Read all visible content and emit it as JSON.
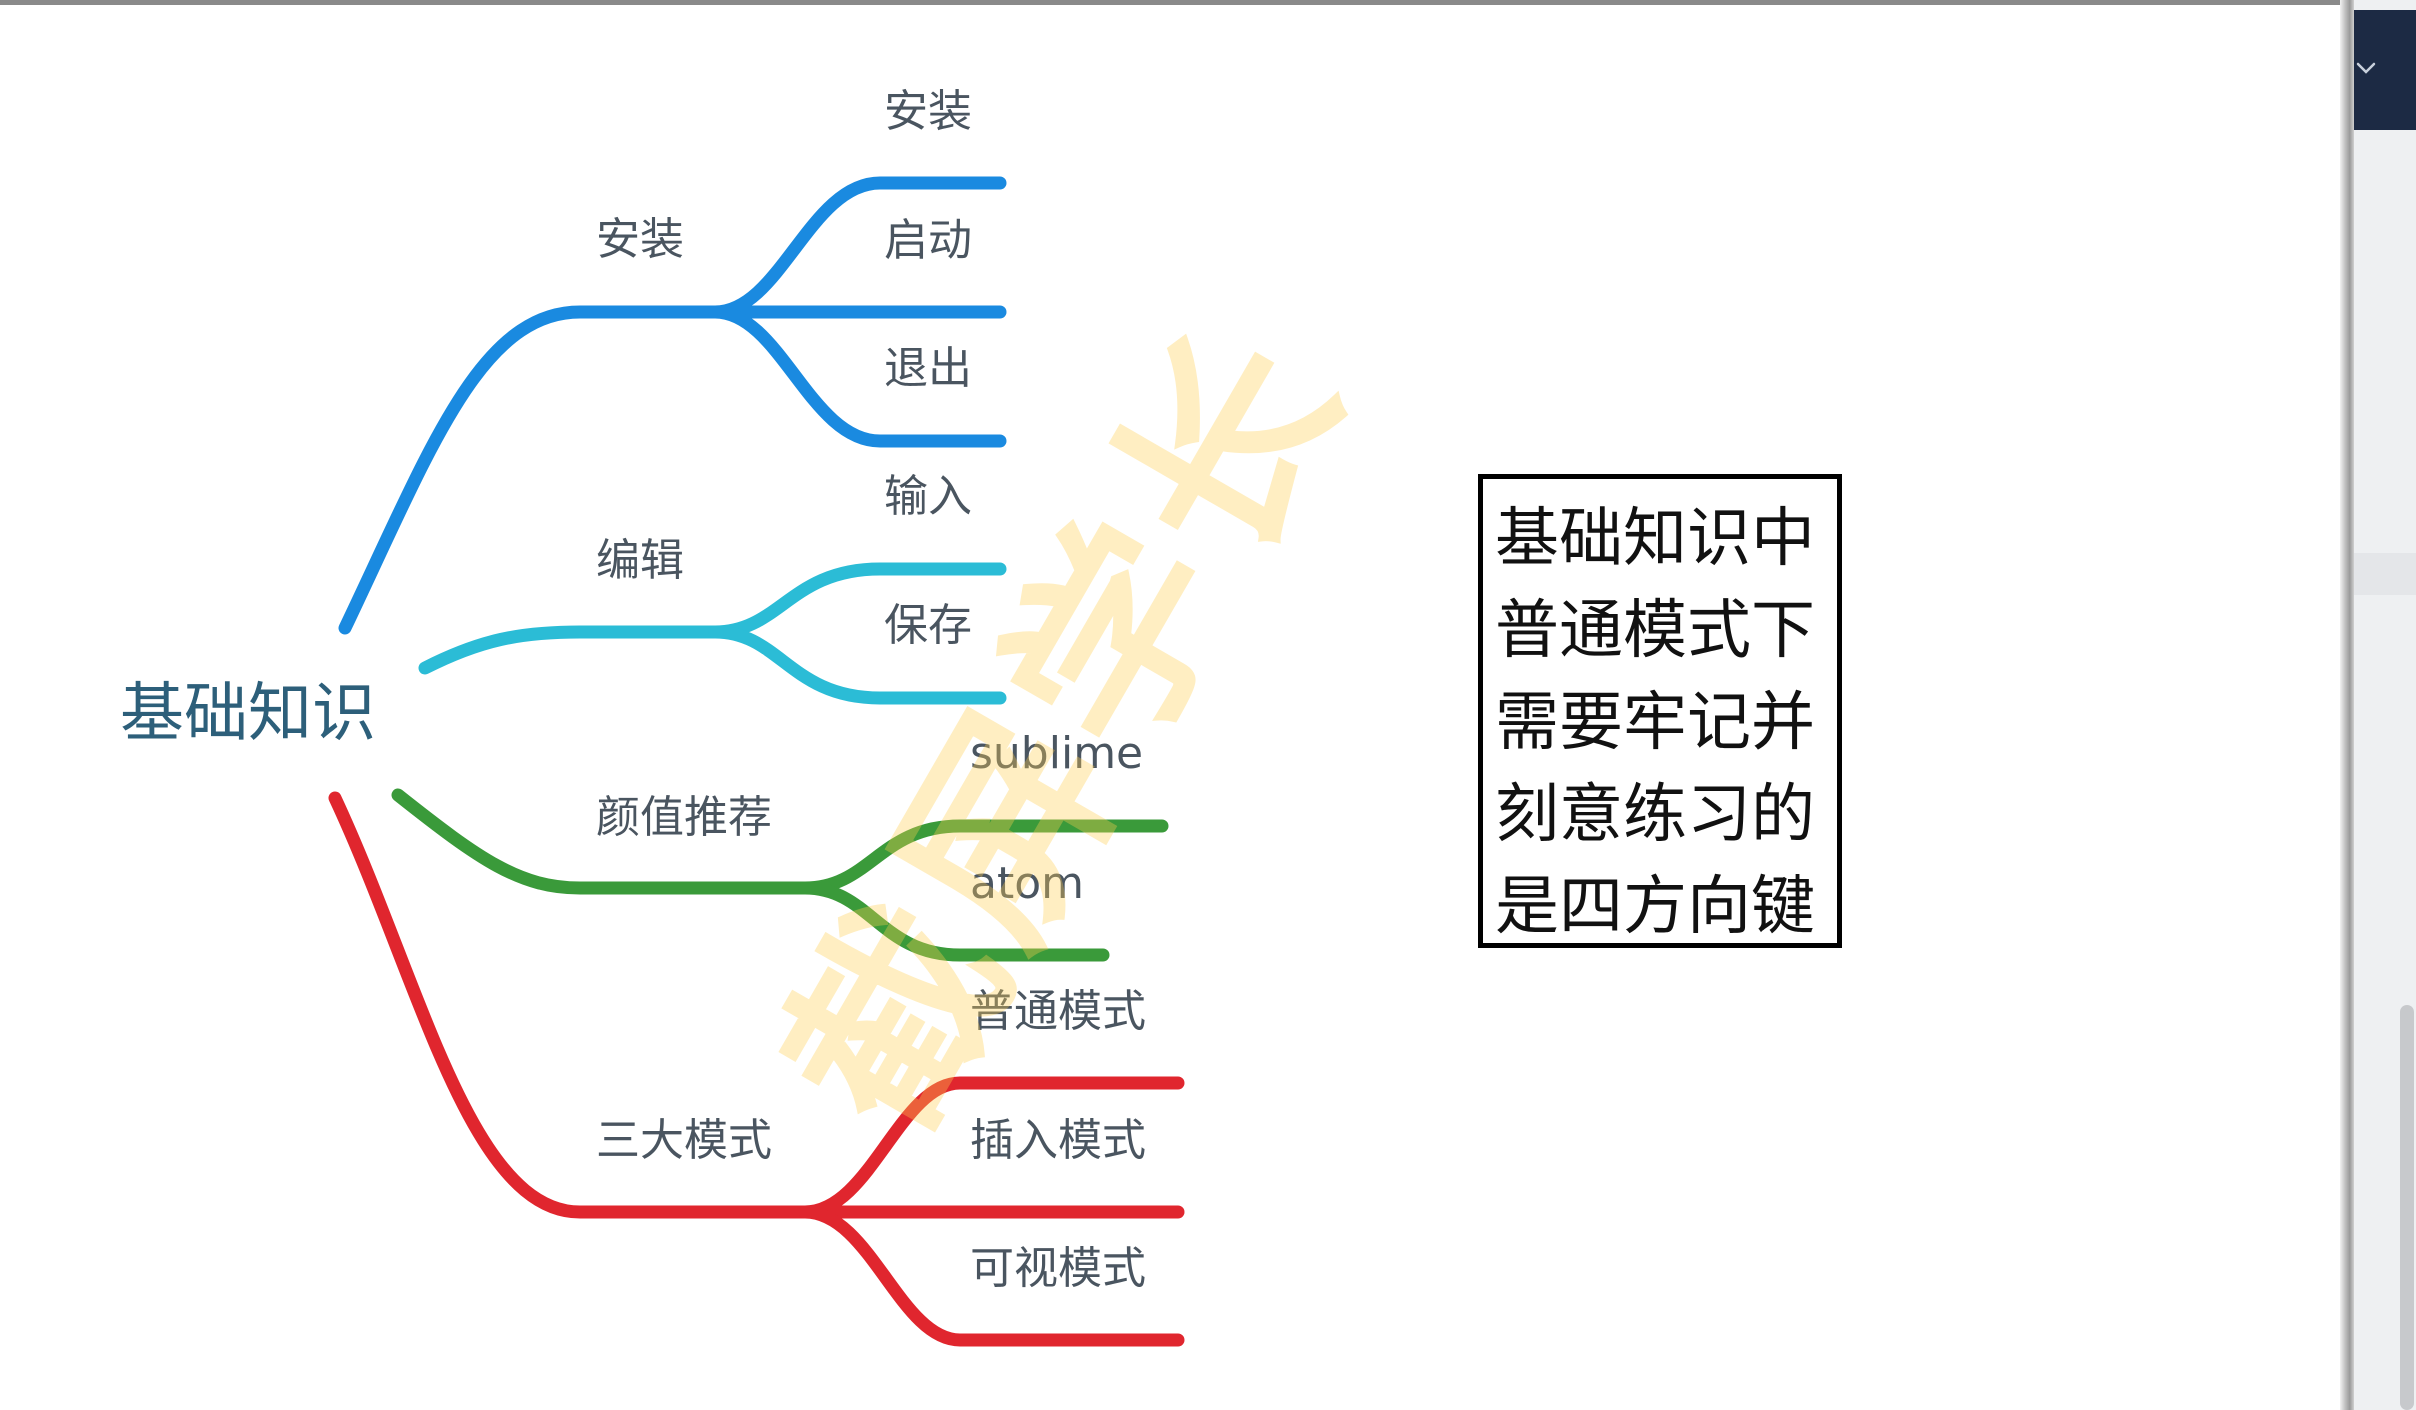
{
  "mindmap": {
    "root": "基础知识",
    "branches": [
      {
        "label": "安装",
        "color": "#1a8ae0",
        "children": [
          "安装",
          "启动",
          "退出"
        ]
      },
      {
        "label": "编辑",
        "color": "#2bbcd6",
        "children": [
          "输入",
          "保存"
        ]
      },
      {
        "label": "颜值推荐",
        "color": "#3a9a3a",
        "children": [
          "sublime",
          "atom"
        ]
      },
      {
        "label": "三大模式",
        "color": "#e0262e",
        "children": [
          "普通模式",
          "插入模式",
          "可视模式"
        ]
      }
    ]
  },
  "watermark": "截屏学长",
  "note": {
    "lines": [
      "基础知识中",
      "普通模式下",
      "需要牢记并",
      "刻意练习的",
      "是四方向键"
    ]
  },
  "ui": {
    "collapse_icon": "chevron-down-icon"
  }
}
